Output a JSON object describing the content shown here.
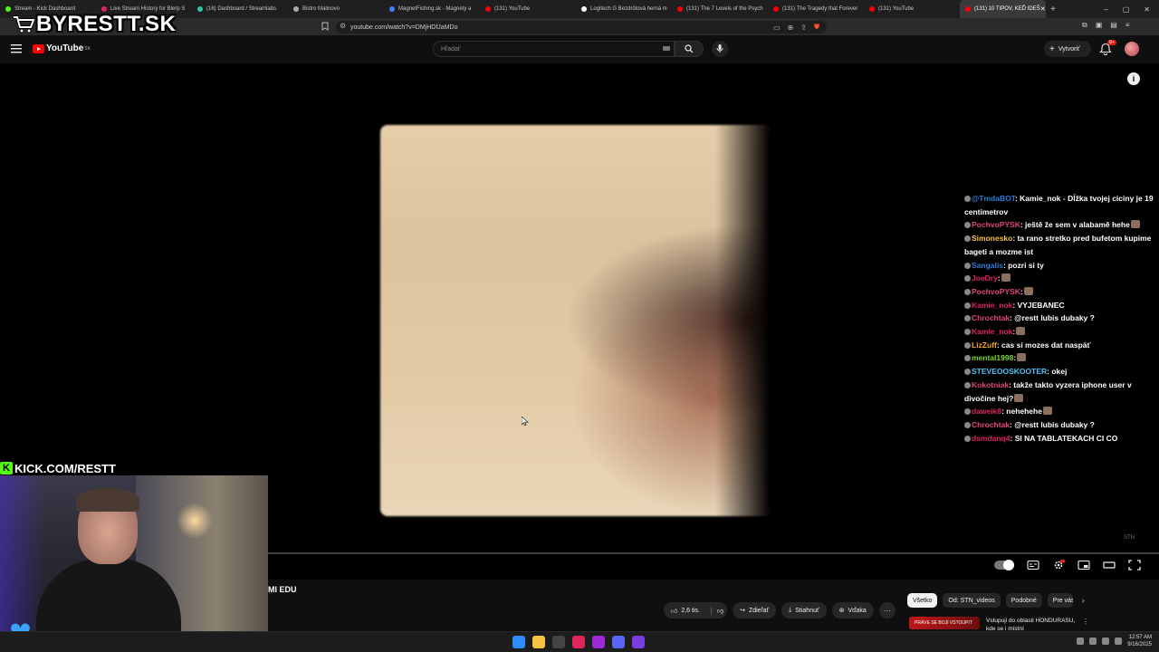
{
  "browser": {
    "tabs": [
      {
        "title": "Stream - Kick Dashboard",
        "color": "#53fc18"
      },
      {
        "title": "Live Stream History for Blerp S",
        "color": "#e0245e"
      },
      {
        "title": "(16) Dashboard / Streamlabs",
        "color": "#31c3a2"
      },
      {
        "title": "Bistro Malinovo",
        "color": "#aaaaaa"
      },
      {
        "title": "MagnetFishing.sk - Magnety a",
        "color": "#3b82f6"
      },
      {
        "title": "(131) YouTube",
        "color": "#ff0000"
      },
      {
        "title": "Logitech G Bezdrôtová herná m",
        "color": "#ffffff"
      },
      {
        "title": "(131) The 7 Levels of the Psych",
        "color": "#ff0000"
      },
      {
        "title": "(131) The Tragedy that Forever",
        "color": "#ff0000"
      },
      {
        "title": "(131) YouTube",
        "color": "#ff0000"
      }
    ],
    "active_tab": {
      "title": "(131) 10 TIPOV, KEĎ IDEŠ",
      "color": "#ff0000"
    },
    "new_tab_label": "+",
    "window_controls": [
      "–",
      "▢",
      "✕"
    ],
    "url": "youtube.com/watch?v=DMjHDfJaMDo"
  },
  "overlay": {
    "logo_text": "BYRESTT.SK",
    "kick_text": "KICK.COM/RESTT",
    "kick_k": "K"
  },
  "youtube": {
    "logo": "YouTube",
    "region": "SK",
    "search_placeholder": "Hľadať",
    "create_label": "Vytvoriť",
    "notifications": "9+"
  },
  "player": {
    "info_label": "i",
    "watermark": "STN",
    "progress_fraction": 0.0
  },
  "chat": [
    {
      "user": "@TmdaBOT",
      "user_color": "#2f7bd6",
      "text": ": Kamie_nok - Dĺžka tvojej ciciny je 19 centimetrov"
    },
    {
      "user": "PochvoPYSK",
      "user_color": "#e0467c",
      "text": ": ještě že sem v alabamě hehe",
      "emote": true
    },
    {
      "user": "Simonesko",
      "user_color": "#f5c242",
      "text": ": ta rano stretko pred bufetom kupime bageti a mozme ist"
    },
    {
      "user": "Sangalis",
      "user_color": "#2f7bd6",
      "text": ": pozri si ty"
    },
    {
      "user": "JoeDry",
      "user_color": "#e0245e",
      "text": ":",
      "emote": true
    },
    {
      "user": "PochvoPYSK",
      "user_color": "#e0467c",
      "text": ":",
      "emote": true
    },
    {
      "user": "Kamie_nok",
      "user_color": "#e0245e",
      "text": ": VYJEBANEC"
    },
    {
      "user": "Chrochtak",
      "user_color": "#e0467c",
      "text": ": @restt lubis dubaky ?"
    },
    {
      "user": "Kamie_nok",
      "user_color": "#e0245e",
      "text": ":",
      "emote": true
    },
    {
      "user": "LizZuff",
      "user_color": "#f5a623",
      "text": ": cas si mozes dat naspäť"
    },
    {
      "user": "mental1998",
      "user_color": "#7ed321",
      "text": ":",
      "emote": true
    },
    {
      "user": "STEVEOOSKOOTER",
      "user_color": "#4fc3f7",
      "text": ": okej"
    },
    {
      "user": "Kokotniak",
      "user_color": "#e0467c",
      "text": ": takže takto vyzera iphone user v divočine hej?",
      "emote": true
    },
    {
      "user": "daweik8",
      "user_color": "#e0245e",
      "text": ": nehehehe",
      "emote": true
    },
    {
      "user": "Chrochtak",
      "user_color": "#e0467c",
      "text": ": @restt lubis dubaky ?"
    },
    {
      "user": "dsmdanq4",
      "user_color": "#e0245e",
      "text": ": SI NA TABLATEKACH CI CO"
    }
  ],
  "below": {
    "title": "MI EDU",
    "likes": "2,6 tis.",
    "share": "Zdieľať",
    "download": "Stiahnuť",
    "thanks": "Vďaka",
    "more": "···",
    "chips": [
      "Všetko",
      "Od: STN_videos",
      "Podobné",
      "Pre vás"
    ],
    "chip_next": "›",
    "rec_thumb_text": "PRÁVE SE BOJÍ VSTOUPIT",
    "rec_title": "Vstupuji do oblasti HONDURASU, kde se i místní",
    "rec_more": "⋮"
  },
  "taskbar": {
    "time": "12:57 AM",
    "date": "9/16/2025",
    "apps": [
      "#2f8cff",
      "#f5c242",
      "#444444",
      "#e0245e",
      "#9a2bd6",
      "#5865f2",
      "#7a3de0"
    ]
  }
}
